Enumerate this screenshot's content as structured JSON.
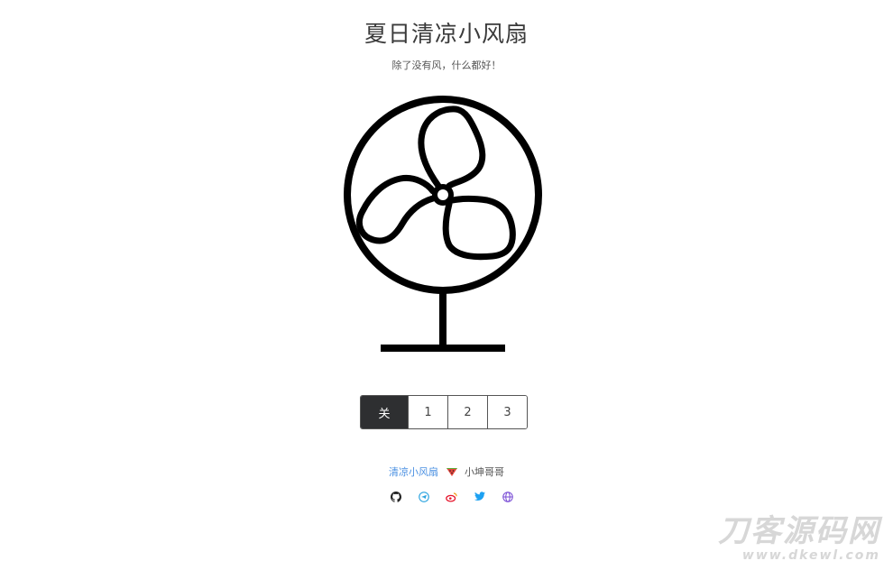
{
  "header": {
    "title": "夏日清凉小风扇",
    "subtitle": "除了没有风，什么都好！"
  },
  "fan": {
    "icon": "fan-icon",
    "stroke_color": "#000000"
  },
  "speed_controls": {
    "options": [
      "关",
      "1",
      "2",
      "3"
    ],
    "selected": "关",
    "active_color": "#2e2f31"
  },
  "footer": {
    "link_text": "清凉小风扇",
    "link_color": "#4a90e2",
    "emoji_icon": "watermelon-icon",
    "author": "小坤哥哥",
    "social": [
      {
        "name": "github-icon",
        "color": "#222222"
      },
      {
        "name": "telegram-icon",
        "color": "#2aa3df"
      },
      {
        "name": "weibo-icon",
        "color": "#e6162d"
      },
      {
        "name": "twitter-icon",
        "color": "#1da1f2"
      },
      {
        "name": "globe-icon",
        "color": "#7b4fd6"
      }
    ]
  },
  "watermark": {
    "main": "刀客源码网",
    "sub": "www.dkewl.com"
  }
}
